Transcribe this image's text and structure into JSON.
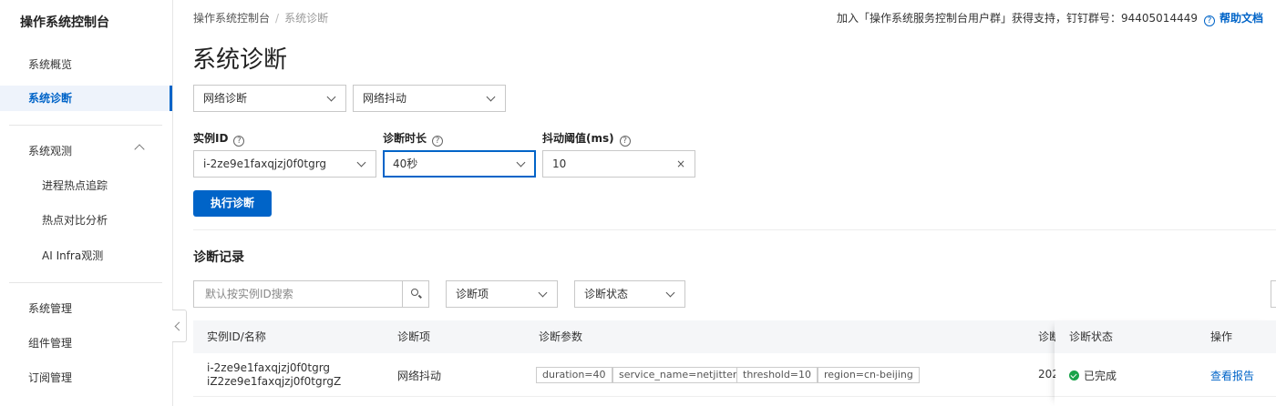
{
  "sidebar": {
    "title": "操作系统控制台",
    "items": [
      {
        "label": "系统概览"
      },
      {
        "label": "系统诊断"
      },
      {
        "label": "系统观测"
      },
      {
        "label": "进程热点追踪"
      },
      {
        "label": "热点对比分析"
      },
      {
        "label": "AI Infra观测"
      },
      {
        "label": "系统管理"
      },
      {
        "label": "组件管理"
      },
      {
        "label": "订阅管理"
      }
    ]
  },
  "header": {
    "breadcrumb": [
      "操作系统控制台",
      "系统诊断"
    ],
    "breadcrumb_sep": "/",
    "support_text": "加入「操作系统服务控制台用户群」获得支持，钉钉群号：94405014449",
    "help_label": "帮助文档",
    "page_title": "系统诊断"
  },
  "diagnosis_type": {
    "category": "网络诊断",
    "item": "网络抖动"
  },
  "form": {
    "instance_label": "实例ID",
    "instance_value": "i-2ze9e1faxqjzj0f0tgrg",
    "duration_label": "诊断时长",
    "duration_value": "40秒",
    "threshold_label": "抖动阈值(ms)",
    "threshold_value": "10",
    "clear_icon": "×",
    "run_button": "执行诊断"
  },
  "records": {
    "title": "诊断记录",
    "search_placeholder": "默认按实例ID搜索",
    "filter_item": "诊断项",
    "filter_status": "诊断状态",
    "columns": [
      "实例ID/名称",
      "诊断项",
      "诊断参数",
      "诊断",
      "诊断状态",
      "操作"
    ],
    "rows": [
      {
        "instance_id": "i-2ze9e1faxqjzj0f0tgrg",
        "instance_name": "iZ2ze9e1faxqjzj0f0tgrgZ",
        "item": "网络抖动",
        "params": [
          "duration=40",
          "service_name=netjitter",
          "threshold=10",
          "region=cn-beijing"
        ],
        "time_partial": "202",
        "status": "已完成",
        "action": "查看报告"
      }
    ]
  },
  "colors": {
    "accent": "#0064c8",
    "success": "#1aa34a"
  }
}
